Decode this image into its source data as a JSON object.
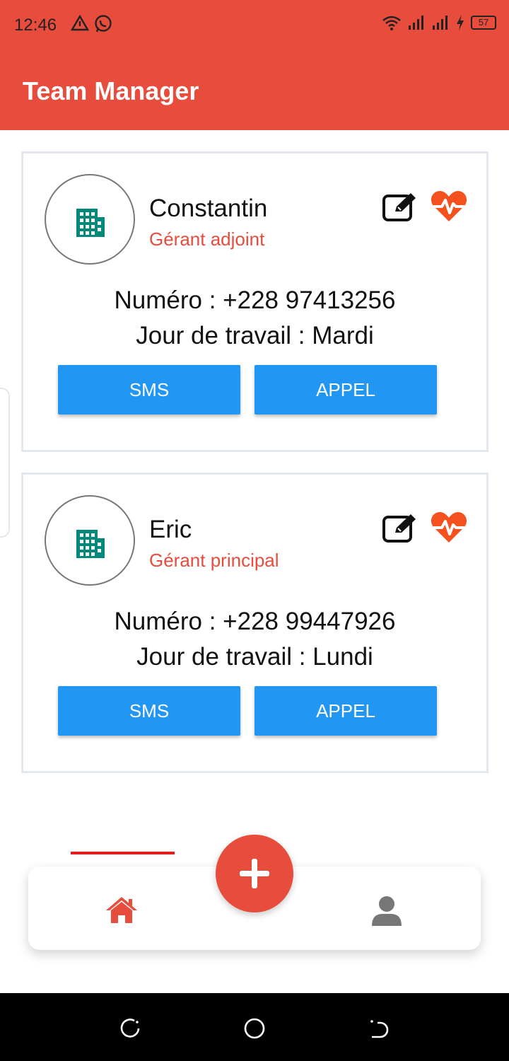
{
  "status_bar": {
    "time": "12:46",
    "battery": "57",
    "icons": [
      "alert-triangle-icon",
      "whatsapp-icon",
      "wifi-icon",
      "signal-icon",
      "signal-icon",
      "charging-icon",
      "battery-icon"
    ]
  },
  "app": {
    "title": "Team Manager",
    "accent_color": "#e74c3c",
    "button_color": "#2196f3"
  },
  "members": [
    {
      "name": "Constantin",
      "role": "Gérant adjoint",
      "numero": "Numéro : +228 97413256",
      "jour": "Jour de travail : Mardi",
      "sms_label": "SMS",
      "appel_label": "APPEL",
      "avatar_icon": "building-icon"
    },
    {
      "name": "Eric",
      "role": "Gérant principal",
      "numero": "Numéro : +228 99447926",
      "jour": "Jour de travail : Lundi",
      "sms_label": "SMS",
      "appel_label": "APPEL",
      "avatar_icon": "building-icon"
    }
  ],
  "bottom_nav": {
    "items": [
      "home-icon",
      "add-icon",
      "profile-icon"
    ],
    "active": "home"
  }
}
